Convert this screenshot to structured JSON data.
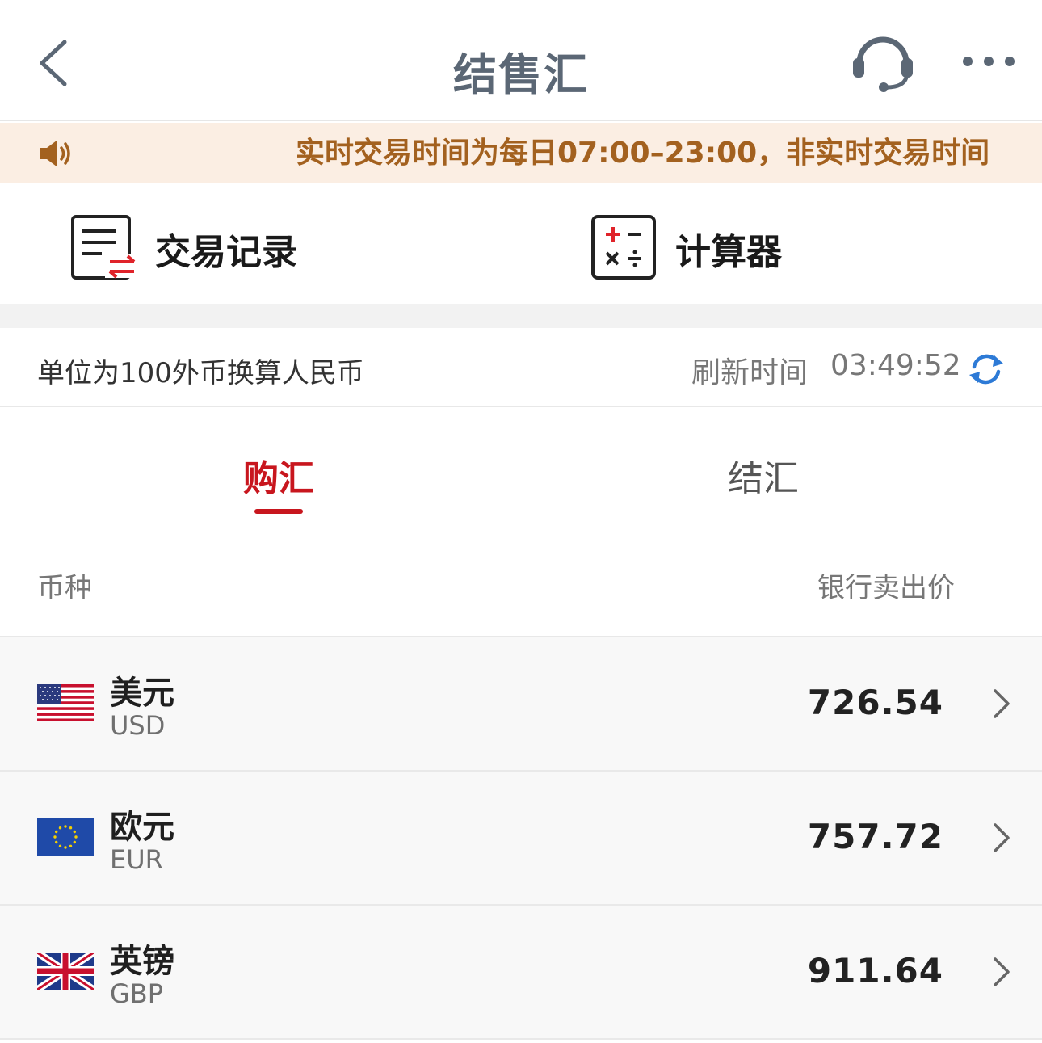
{
  "nav": {
    "title": "结售汇",
    "back_icon": "chevron-left-icon",
    "customer_service_icon": "headset-icon",
    "more_icon": "more-dots-icon"
  },
  "notice": {
    "icon": "speaker-icon",
    "text": "实时交易时间为每日07:00–23:00，非实时交易时间"
  },
  "quick_actions": [
    {
      "label": "交易记录",
      "icon": "transaction-record-icon"
    },
    {
      "label": "计算器",
      "icon": "calculator-icon"
    }
  ],
  "info": {
    "unit_text": "单位为100外币换算人民币",
    "refresh_label": "刷新时间",
    "refresh_time": "03:49:52",
    "refresh_icon": "refresh-icon"
  },
  "tabs": [
    {
      "label": "购汇",
      "active": true
    },
    {
      "label": "结汇",
      "active": false
    }
  ],
  "table": {
    "col_currency": "币种",
    "col_price": "银行卖出价",
    "rows": [
      {
        "name": "美元",
        "code": "USD",
        "price": "726.54",
        "flag": "us-flag-icon"
      },
      {
        "name": "欧元",
        "code": "EUR",
        "price": "757.72",
        "flag": "eu-flag-icon"
      },
      {
        "name": "英镑",
        "code": "GBP",
        "price": "911.64",
        "flag": "uk-flag-icon"
      }
    ]
  },
  "colors": {
    "accent": "#c8161e",
    "notice_text": "#a3611f",
    "notice_bg": "#fbeee3",
    "title": "#5b6775"
  }
}
